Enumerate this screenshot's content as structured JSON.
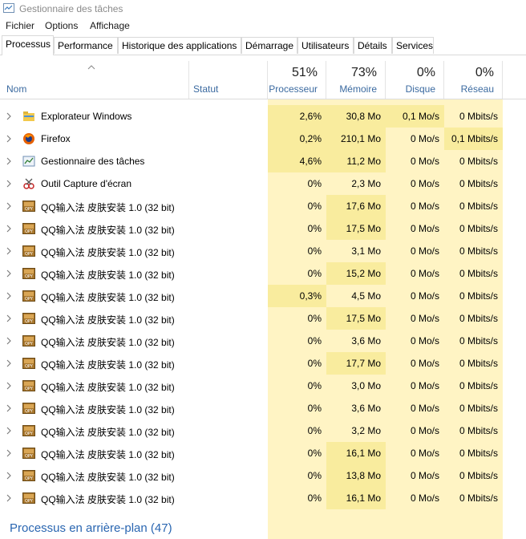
{
  "window": {
    "title": "Gestionnaire des tâches"
  },
  "menu": [
    "Fichier",
    "Options",
    "Affichage"
  ],
  "tabs": [
    "Processus",
    "Performance",
    "Historique des applications",
    "Démarrage",
    "Utilisateurs",
    "Détails",
    "Services"
  ],
  "active_tab": "Processus",
  "columns": {
    "name": "Nom",
    "status": "Statut",
    "cpu": {
      "pct": "51%",
      "label": "Processeur"
    },
    "mem": {
      "pct": "73%",
      "label": "Mémoire"
    },
    "disk": {
      "pct": "0%",
      "label": "Disque"
    },
    "net": {
      "pct": "0%",
      "label": "Réseau"
    }
  },
  "rows": [
    {
      "icon": "folder-icon",
      "name": "Explorateur Windows",
      "cpu": "2,6%",
      "mem": "30,8 Mo",
      "disk": "0,1 Mo/s",
      "net": "0 Mbits/s"
    },
    {
      "icon": "firefox-icon",
      "name": "Firefox",
      "cpu": "0,2%",
      "mem": "210,1 Mo",
      "disk": "0 Mo/s",
      "net": "0,1 Mbits/s"
    },
    {
      "icon": "task-manager-icon",
      "name": "Gestionnaire des tâches",
      "cpu": "4,6%",
      "mem": "11,2 Mo",
      "disk": "0 Mo/s",
      "net": "0 Mbits/s"
    },
    {
      "icon": "snipping-tool-icon",
      "name": "Outil Capture d'écran",
      "cpu": "0%",
      "mem": "2,3 Mo",
      "disk": "0 Mo/s",
      "net": "0 Mbits/s"
    },
    {
      "icon": "qq-icon",
      "name": "QQ输入法 皮肤安装 1.0 (32 bit)",
      "cpu": "0%",
      "mem": "17,6 Mo",
      "disk": "0 Mo/s",
      "net": "0 Mbits/s"
    },
    {
      "icon": "qq-icon",
      "name": "QQ输入法 皮肤安装 1.0 (32 bit)",
      "cpu": "0%",
      "mem": "17,5 Mo",
      "disk": "0 Mo/s",
      "net": "0 Mbits/s"
    },
    {
      "icon": "qq-icon",
      "name": "QQ输入法 皮肤安装 1.0 (32 bit)",
      "cpu": "0%",
      "mem": "3,1 Mo",
      "disk": "0 Mo/s",
      "net": "0 Mbits/s"
    },
    {
      "icon": "qq-icon",
      "name": "QQ输入法 皮肤安装 1.0 (32 bit)",
      "cpu": "0%",
      "mem": "15,2 Mo",
      "disk": "0 Mo/s",
      "net": "0 Mbits/s"
    },
    {
      "icon": "qq-icon",
      "name": "QQ输入法 皮肤安装 1.0 (32 bit)",
      "cpu": "0,3%",
      "mem": "4,5 Mo",
      "disk": "0 Mo/s",
      "net": "0 Mbits/s"
    },
    {
      "icon": "qq-icon",
      "name": "QQ输入法 皮肤安装 1.0 (32 bit)",
      "cpu": "0%",
      "mem": "17,5 Mo",
      "disk": "0 Mo/s",
      "net": "0 Mbits/s"
    },
    {
      "icon": "qq-icon",
      "name": "QQ输入法 皮肤安装 1.0 (32 bit)",
      "cpu": "0%",
      "mem": "3,6 Mo",
      "disk": "0 Mo/s",
      "net": "0 Mbits/s"
    },
    {
      "icon": "qq-icon",
      "name": "QQ输入法 皮肤安装 1.0 (32 bit)",
      "cpu": "0%",
      "mem": "17,7 Mo",
      "disk": "0 Mo/s",
      "net": "0 Mbits/s"
    },
    {
      "icon": "qq-icon",
      "name": "QQ输入法 皮肤安装 1.0 (32 bit)",
      "cpu": "0%",
      "mem": "3,0 Mo",
      "disk": "0 Mo/s",
      "net": "0 Mbits/s"
    },
    {
      "icon": "qq-icon",
      "name": "QQ输入法 皮肤安装 1.0 (32 bit)",
      "cpu": "0%",
      "mem": "3,6 Mo",
      "disk": "0 Mo/s",
      "net": "0 Mbits/s"
    },
    {
      "icon": "qq-icon",
      "name": "QQ输入法 皮肤安装 1.0 (32 bit)",
      "cpu": "0%",
      "mem": "3,2 Mo",
      "disk": "0 Mo/s",
      "net": "0 Mbits/s"
    },
    {
      "icon": "qq-icon",
      "name": "QQ输入法 皮肤安装 1.0 (32 bit)",
      "cpu": "0%",
      "mem": "16,1 Mo",
      "disk": "0 Mo/s",
      "net": "0 Mbits/s"
    },
    {
      "icon": "qq-icon",
      "name": "QQ输入法 皮肤安装 1.0 (32 bit)",
      "cpu": "0%",
      "mem": "13,8 Mo",
      "disk": "0 Mo/s",
      "net": "0 Mbits/s"
    },
    {
      "icon": "qq-icon",
      "name": "QQ输入法 皮肤安装 1.0 (32 bit)",
      "cpu": "0%",
      "mem": "16,1 Mo",
      "disk": "0 Mo/s",
      "net": "0 Mbits/s"
    }
  ],
  "background_group": "Processus en arrière-plan (47)",
  "colors": {
    "heat_low": "#fff4c4",
    "heat_mid": "#f9ec9e",
    "link": "#2a66b1"
  }
}
